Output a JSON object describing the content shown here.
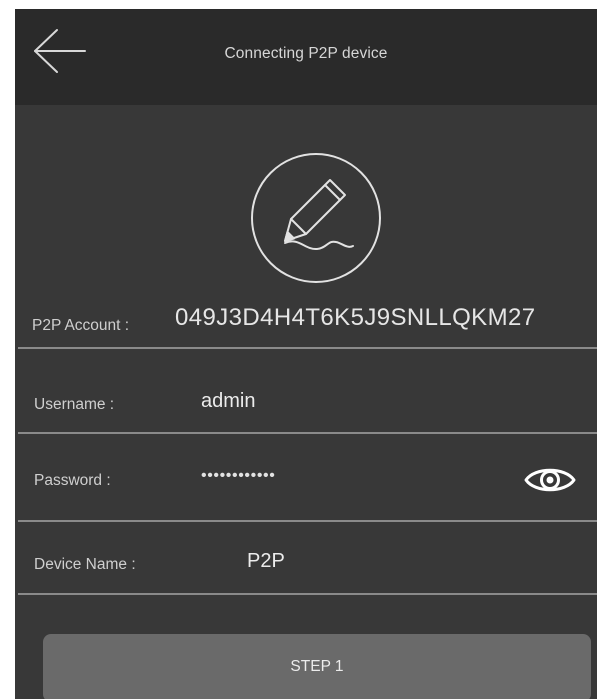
{
  "header": {
    "title": "Connecting P2P device",
    "back_icon": "arrow-left-icon"
  },
  "avatar": {
    "icon": "pencil-signature-icon"
  },
  "account": {
    "label": "P2P Account :",
    "value": "049J3D4H4T6K5J9SNLLQKM27"
  },
  "form": {
    "username": {
      "label": "Username :",
      "value": "admin"
    },
    "password": {
      "label": "Password :",
      "value": "••••••••••••",
      "toggle_icon": "eye-icon"
    },
    "device_name": {
      "label": "Device Name :",
      "value": "P2P"
    }
  },
  "actions": {
    "step_label": "STEP 1"
  },
  "colors": {
    "header_bg": "#2a2a2a",
    "body_bg": "#383838",
    "button_bg": "#6a6a6a",
    "text": "#e6e6e6",
    "divider": "#8a8a8a"
  }
}
